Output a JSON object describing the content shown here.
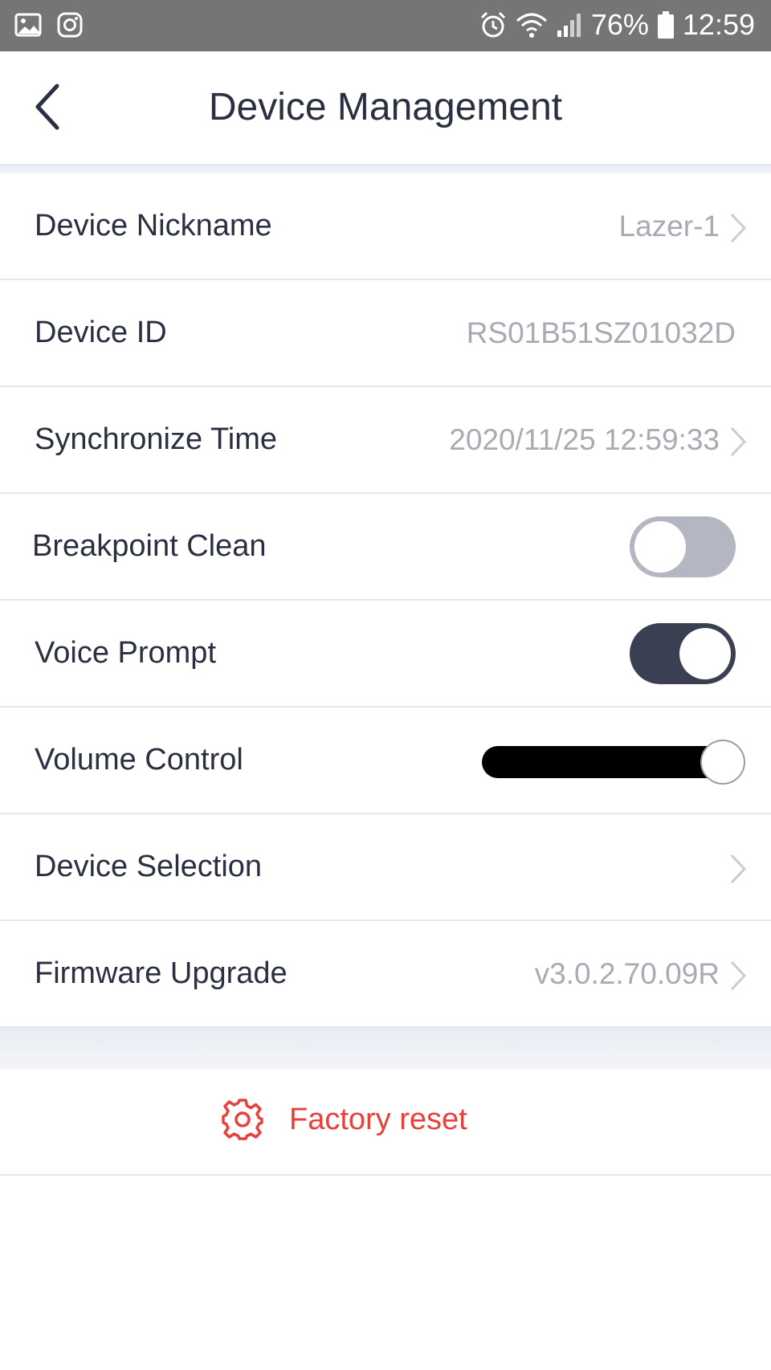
{
  "status_bar": {
    "battery": "76%",
    "time": "12:59",
    "icons": [
      "gallery-icon",
      "instagram-icon",
      "alarm-icon",
      "wifi-icon",
      "signal-icon",
      "battery-icon"
    ]
  },
  "header": {
    "title": "Device Management",
    "back_icon": "chevron-left-icon"
  },
  "settings": {
    "nickname": {
      "label": "Device Nickname",
      "value": "Lazer-1"
    },
    "device_id": {
      "label": "Device ID",
      "value": "RS01B51SZ01032D"
    },
    "sync_time": {
      "label": "Synchronize Time",
      "value": "2020/11/25 12:59:33"
    },
    "breakpoint_clean": {
      "label": "Breakpoint Clean",
      "enabled": false
    },
    "voice_prompt": {
      "label": "Voice Prompt",
      "enabled": true
    },
    "volume_control": {
      "label": "Volume Control",
      "level": 1.0
    },
    "device_selection": {
      "label": "Device Selection"
    },
    "firmware": {
      "label": "Firmware Upgrade",
      "value": "v3.0.2.70.09R"
    }
  },
  "factory_reset": {
    "label": "Factory reset",
    "icon": "gear-icon",
    "color": "#e8403a"
  },
  "colors": {
    "text_primary": "#2b3040",
    "text_secondary": "#a8abb3",
    "toggle_on": "#3b3f52",
    "toggle_off": "#b4b7c1",
    "accent_red": "#e8403a"
  }
}
